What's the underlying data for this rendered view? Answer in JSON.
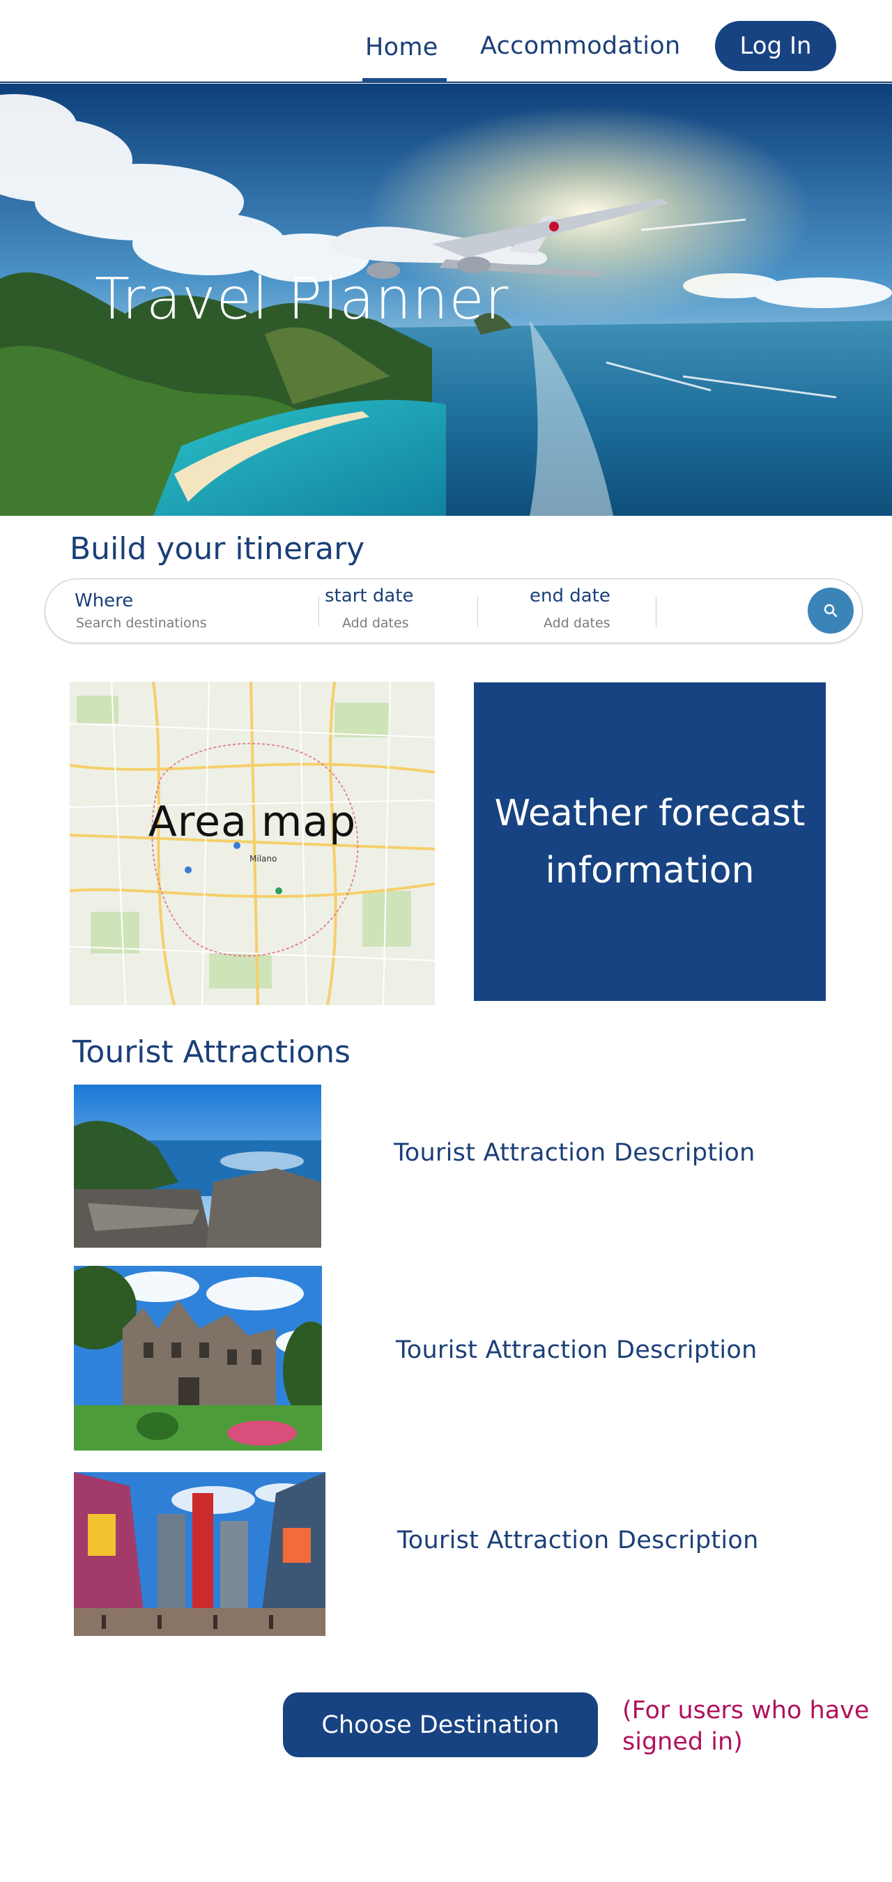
{
  "header": {
    "nav": [
      {
        "label": "Home"
      },
      {
        "label": "Accommodation"
      }
    ],
    "login_label": "Log In"
  },
  "hero": {
    "title": "Travel Planner"
  },
  "itinerary": {
    "title": "Build your itinerary",
    "where_label": "Where",
    "where_placeholder": "Search destinations",
    "start_label": "start date",
    "start_placeholder": "Add dates",
    "end_label": "end date",
    "end_placeholder": "Add dates",
    "search_icon": "search-icon"
  },
  "map": {
    "label": "Area map",
    "city_label": "Milano"
  },
  "weather": {
    "text": "Weather forecast information"
  },
  "attractions": {
    "title": "Tourist Attractions",
    "items": [
      {
        "description": "Tourist Attraction Description"
      },
      {
        "description": "Tourist Attraction Description"
      },
      {
        "description": "Tourist Attraction Description"
      }
    ]
  },
  "cta": {
    "button_label": "Choose Destination",
    "note": "(For users who have signed in)"
  },
  "colors": {
    "primary": "#174382",
    "text": "#1b3f78",
    "accent_note": "#b0115b",
    "search_button": "#3a84b8"
  }
}
